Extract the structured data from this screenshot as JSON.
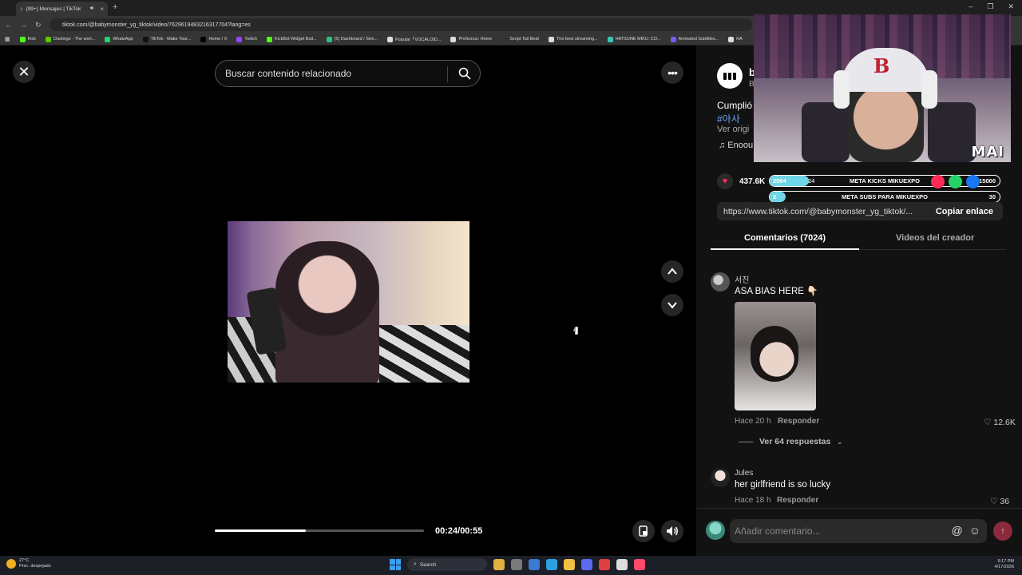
{
  "browser": {
    "tab_title": "(99+) Mensajes | TikTok",
    "url": "tiktok.com/@babymonster_yg_tiktok/video/7629619483216317704?lang=es",
    "bookmarks": [
      {
        "label": "Kick",
        "color": "#53fc18"
      },
      {
        "label": "Duolingo - The worl...",
        "color": "#58cc02"
      },
      {
        "label": "WhatsApp",
        "color": "#25d366"
      },
      {
        "label": "TikTok - Make Your...",
        "color": "#111111"
      },
      {
        "label": "Home / X",
        "color": "#000000"
      },
      {
        "label": "Twitch",
        "color": "#9146ff"
      },
      {
        "label": "KickBot Widget Buil...",
        "color": "#53fc18"
      },
      {
        "label": "(5) Dashboard / Stre...",
        "color": "#2ec27e"
      },
      {
        "label": "Popular「VOCALOID...",
        "color": "#dddddd"
      },
      {
        "label": "PreSonus: Home",
        "color": "#dddddd"
      },
      {
        "label": "Script Tail Beat",
        "color": "#333333"
      },
      {
        "label": "The best streaming...",
        "color": "#dddddd"
      },
      {
        "label": "HATSUNE MIKU: CO...",
        "color": "#39c5bb"
      },
      {
        "label": "Animated Subtitles...",
        "color": "#7a5af5"
      },
      {
        "label": "HA",
        "color": "#dddddd"
      }
    ]
  },
  "video": {
    "search_placeholder": "Buscar contenido relacionado",
    "time": "00:24/00:55",
    "progress": 0.436
  },
  "author": {
    "name": "b",
    "sub": "B",
    "description": "Cumplió",
    "hashtag": "#아사",
    "see_original": "Ver origi",
    "music": "♫ Enoou"
  },
  "stream_overlay": {
    "cam_name": "MAI",
    "likes": "437.6K",
    "goal1_label": "META KICKS MIKUEXPO",
    "goal1_left": "2564",
    "goal1_mid": "24",
    "goal1_right": "15000",
    "goal1_progress": 0.17,
    "goal2_label": "META SUBS PARA MIKUEXPO",
    "goal2_left": "2",
    "goal2_right": "30",
    "goal2_progress": 0.07,
    "share_colors": [
      "#fe2c55",
      "#25d366",
      "#1877f2"
    ]
  },
  "link": {
    "url": "https://www.tiktok.com/@babymonster_yg_tiktok/...",
    "copy_label": "Copiar enlace"
  },
  "tabs": {
    "comments": "Comentarios (7024)",
    "creator_videos": "Videos del creador"
  },
  "comments": [
    {
      "user": "서진",
      "text": "ASA BIAS HERE 👇🏻",
      "time": "Hace 20 h",
      "reply": "Responder",
      "likes": "12.6K",
      "replies": "Ver 64 respuestas"
    },
    {
      "user": "Jules",
      "text": "her girlfriend is so lucky",
      "time": "Hace 18 h",
      "reply": "Responder",
      "likes": "36"
    }
  ],
  "comment_input": {
    "placeholder": "Añadir comentario..."
  },
  "taskbar": {
    "temp": "27°C",
    "weather": "Prec. despejado",
    "search": "Search",
    "time": "9:17 PM",
    "date": "4/17/2026",
    "apps": [
      "#e0b040",
      "#7a7a7a",
      "#3a7ad0",
      "#2aa0e0",
      "#f0c040",
      "#5a6af0",
      "#e04040",
      "#dddddd",
      "#ff4a6a"
    ]
  }
}
